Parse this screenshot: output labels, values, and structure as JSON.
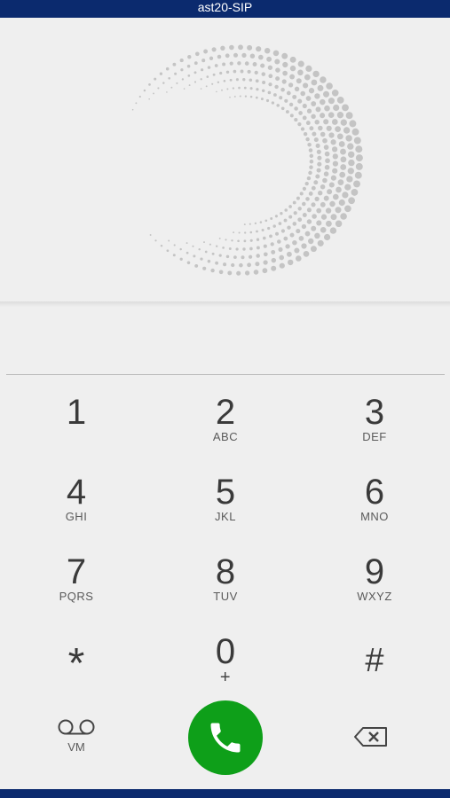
{
  "title": "ast20-SIP",
  "display": {
    "number": ""
  },
  "keypad": [
    {
      "digit": "1",
      "letters": ""
    },
    {
      "digit": "2",
      "letters": "ABC"
    },
    {
      "digit": "3",
      "letters": "DEF"
    },
    {
      "digit": "4",
      "letters": "GHI"
    },
    {
      "digit": "5",
      "letters": "JKL"
    },
    {
      "digit": "6",
      "letters": "MNO"
    },
    {
      "digit": "7",
      "letters": "PQRS"
    },
    {
      "digit": "8",
      "letters": "TUV"
    },
    {
      "digit": "9",
      "letters": "WXYZ"
    },
    {
      "digit": "*",
      "letters": ""
    },
    {
      "digit": "0",
      "letters": "+"
    },
    {
      "digit": "#",
      "letters": ""
    }
  ],
  "voicemail": {
    "label": "VM",
    "icon": "voicemail-icon"
  },
  "call": {
    "icon": "phone-icon",
    "color": "#0e9f19"
  },
  "backspace": {
    "icon": "backspace-icon"
  },
  "colors": {
    "bar": "#0b2a6e",
    "background": "#efefef"
  }
}
